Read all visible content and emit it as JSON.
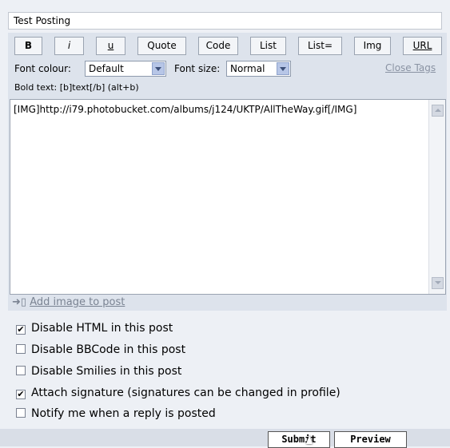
{
  "subject": {
    "value": "Test Posting"
  },
  "toolbar": {
    "buttons": [
      {
        "label": "B"
      },
      {
        "label": "i"
      },
      {
        "label": "u"
      },
      {
        "label": "Quote"
      },
      {
        "label": "Code"
      },
      {
        "label": "List"
      },
      {
        "label": "List="
      },
      {
        "label": "Img"
      },
      {
        "label": "URL"
      }
    ]
  },
  "font_colour": {
    "label": "Font colour:",
    "value": "Default"
  },
  "font_size": {
    "label": "Font size:",
    "value": "Normal"
  },
  "close_tags": "Close Tags",
  "hint": "Bold text: [b]text[/b]  (alt+b)",
  "message": {
    "value": "[IMG]http://i79.photobucket.com/albums/j124/UKTP/AllTheWay.gif[/IMG]"
  },
  "add_image": {
    "icon_glyph": "➜▯",
    "label": "Add image to post"
  },
  "options": [
    {
      "label": "Disable HTML in this post",
      "checked": true
    },
    {
      "label": "Disable BBCode in this post",
      "checked": false
    },
    {
      "label": "Disable Smilies in this post",
      "checked": false
    },
    {
      "label": "Attach signature (signatures can be changed in profile)",
      "checked": true
    },
    {
      "label": "Notify me when a reply is posted",
      "checked": false
    }
  ],
  "actions": {
    "submit": "Submit",
    "preview": "Preview"
  },
  "check_glyph": "✔"
}
